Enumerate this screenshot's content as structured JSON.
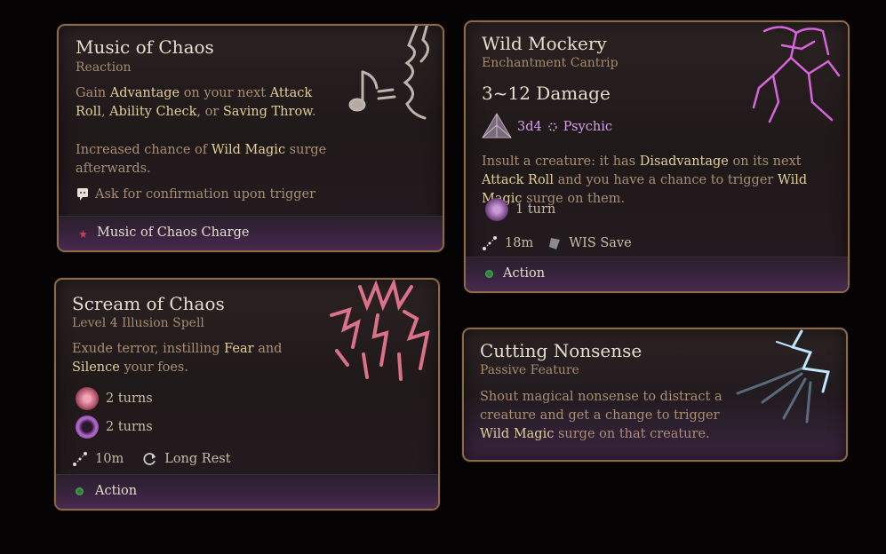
{
  "cards": {
    "music": {
      "title": "Music of Chaos",
      "subtitle": "Reaction",
      "desc1": {
        "p1": "Gain ",
        "h1": "Advantage",
        "p2": " on your next ",
        "h2": "Attack Roll",
        "p3": ",",
        "h3": "Ability Check",
        "p4": ", or ",
        "h4": "Saving Throw",
        "p5": "."
      },
      "desc2": {
        "p1": "Increased chance of ",
        "h1": "Wild Magic",
        "p2": " surge afterwards."
      },
      "confirm": "Ask for confirmation upon trigger",
      "footer": "Music of Chaos Charge",
      "icon": "music-chaos-art"
    },
    "mockery": {
      "title": "Wild Mockery",
      "subtitle": "Enchantment Cantrip",
      "damage": "3~12 Damage",
      "dice": "3d4",
      "damage_type": "Psychic",
      "desc": {
        "p1": "Insult a creature: it has ",
        "h1": "Disadvantage",
        "p2": " on its next ",
        "h2": "Attack Roll",
        "p3": " and you have a chance to trigger ",
        "h3": "Wild Magic",
        "p4": " surge on them."
      },
      "duration": "1 turn",
      "range": "18m",
      "save": "WIS Save",
      "footer": "Action",
      "icon": "wild-mockery-art"
    },
    "scream": {
      "title": "Scream of Chaos",
      "subtitle": "Level 4 Illusion Spell",
      "desc": {
        "p1": "Exude terror, instilling ",
        "h1": "Fear",
        "p2": " and ",
        "h2": "Silence",
        "p3": " your foes."
      },
      "status1": "2 turns",
      "status2": "2 turns",
      "range": "10m",
      "recharge": "Long Rest",
      "footer": "Action",
      "icon": "scream-chaos-art"
    },
    "nonsense": {
      "title": "Cutting Nonsense",
      "subtitle": "Passive Feature",
      "desc": {
        "p1": "Shout magical nonsense to distract a creature and get a change to trigger ",
        "h1": "Wild Magic",
        "p2": " surge on that creature."
      },
      "icon": "cutting-nonsense-art"
    }
  },
  "colors": {
    "border": "#8a6a47",
    "highlight": "#e2cf95",
    "action_dot": "#2f7a3d",
    "psychic": "#d6a0e8"
  }
}
